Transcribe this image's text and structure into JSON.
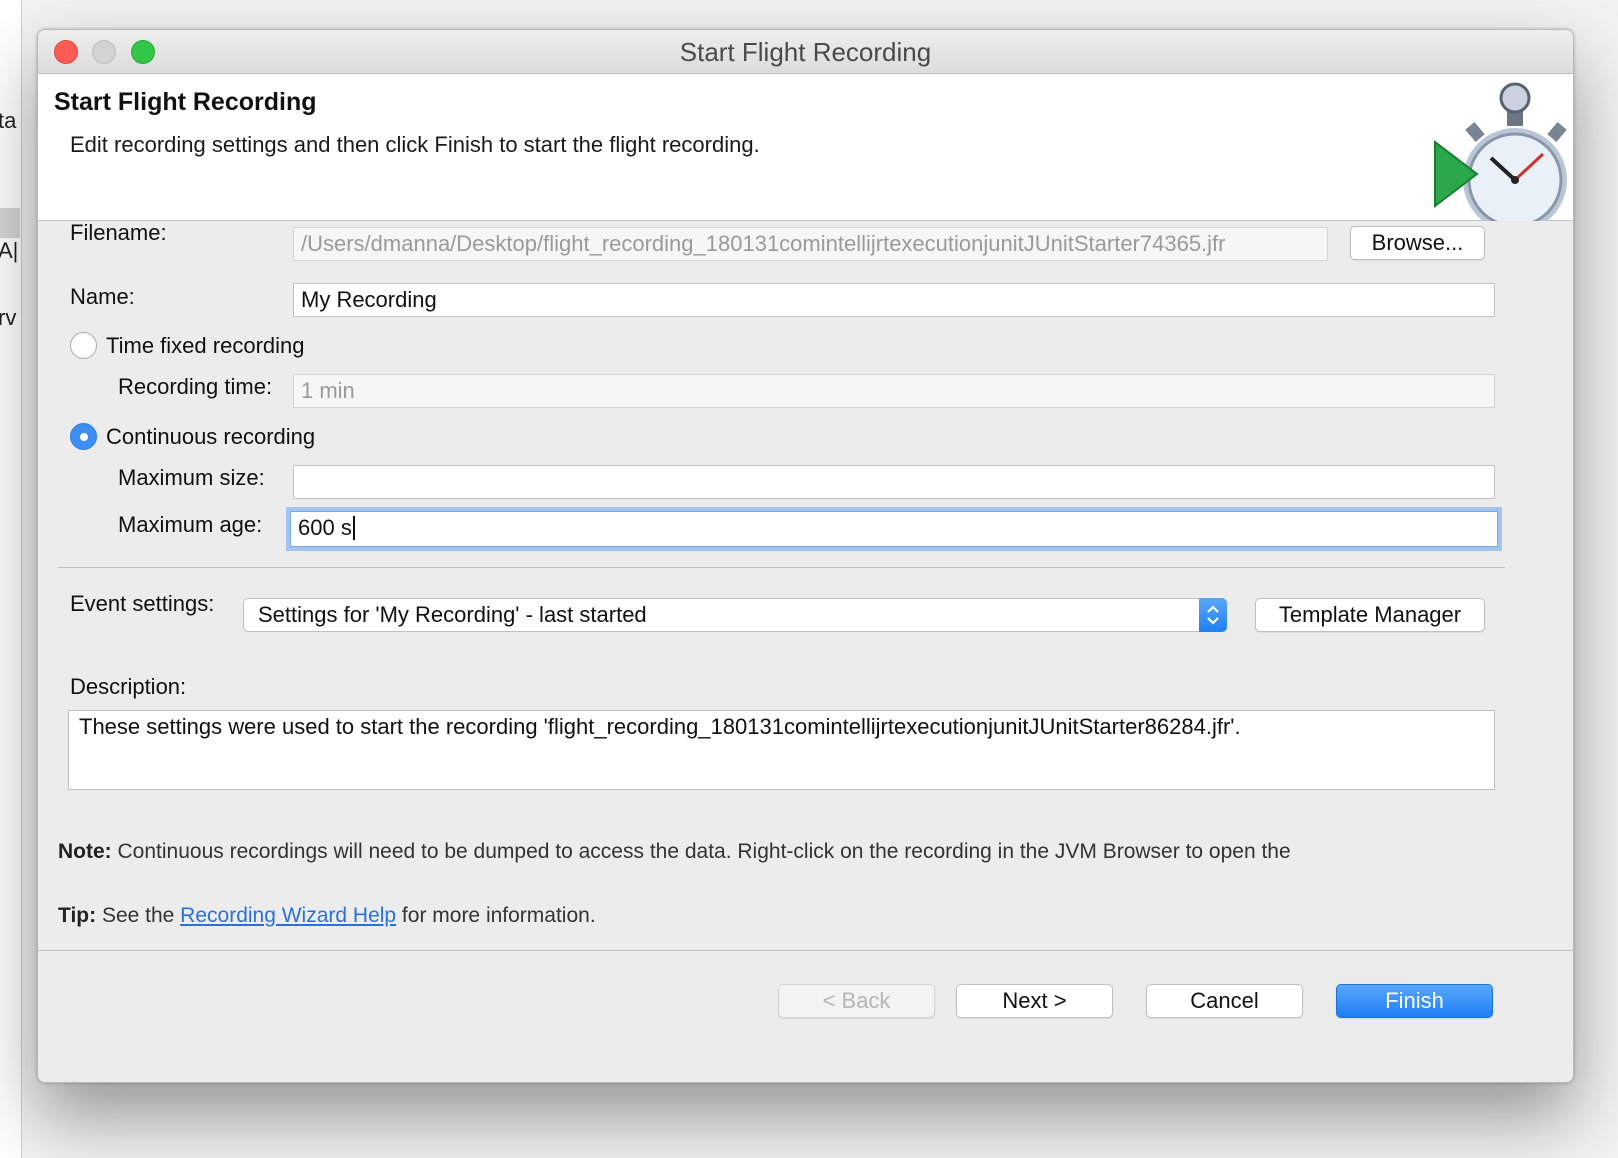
{
  "background_app": {
    "fragments": [
      "ta",
      "A|",
      "rv"
    ]
  },
  "window": {
    "title": "Start Flight Recording"
  },
  "header": {
    "title": "Start Flight Recording",
    "subtitle": "Edit recording settings and then click Finish to start the flight recording.",
    "icon": "flight-recorder-stopwatch-icon"
  },
  "form": {
    "filename_label": "Filename:",
    "filename_value": "/Users/dmanna/Desktop/flight_recording_180131comintellijrtexecutionjunitJUnitStarter74365.jfr",
    "browse_label": "Browse...",
    "name_label": "Name:",
    "name_value": "My Recording",
    "time_fixed_label": "Time fixed recording",
    "time_fixed_checked": false,
    "recording_time_label": "Recording time:",
    "recording_time_value": "1 min",
    "continuous_label": "Continuous recording",
    "continuous_checked": true,
    "max_size_label": "Maximum size:",
    "max_size_value": "",
    "max_age_label": "Maximum age:",
    "max_age_value": "600 s"
  },
  "events": {
    "label": "Event settings:",
    "selected": "Settings for 'My Recording' - last started",
    "template_manager_label": "Template Manager"
  },
  "description": {
    "label": "Description:",
    "text": "These settings were used to start the recording 'flight_recording_180131comintellijrtexecutionjunitJUnitStarter86284.jfr'."
  },
  "notes": {
    "note_bold": "Note:",
    "note_text": " Continuous recordings will need to be dumped to access the data. Right-click on the recording in the JVM Browser to open the",
    "tip_bold": "Tip:",
    "tip_pre": " See the ",
    "tip_link": "Recording Wizard Help",
    "tip_post": " for more information."
  },
  "buttons": {
    "back": "< Back",
    "next": "Next >",
    "cancel": "Cancel",
    "finish": "Finish"
  },
  "colors": {
    "accent": "#1d7ff6",
    "link": "#2a72d8",
    "close": "#fd5c55",
    "maximize": "#33c748",
    "focus_ring": "#a2c5ee"
  }
}
